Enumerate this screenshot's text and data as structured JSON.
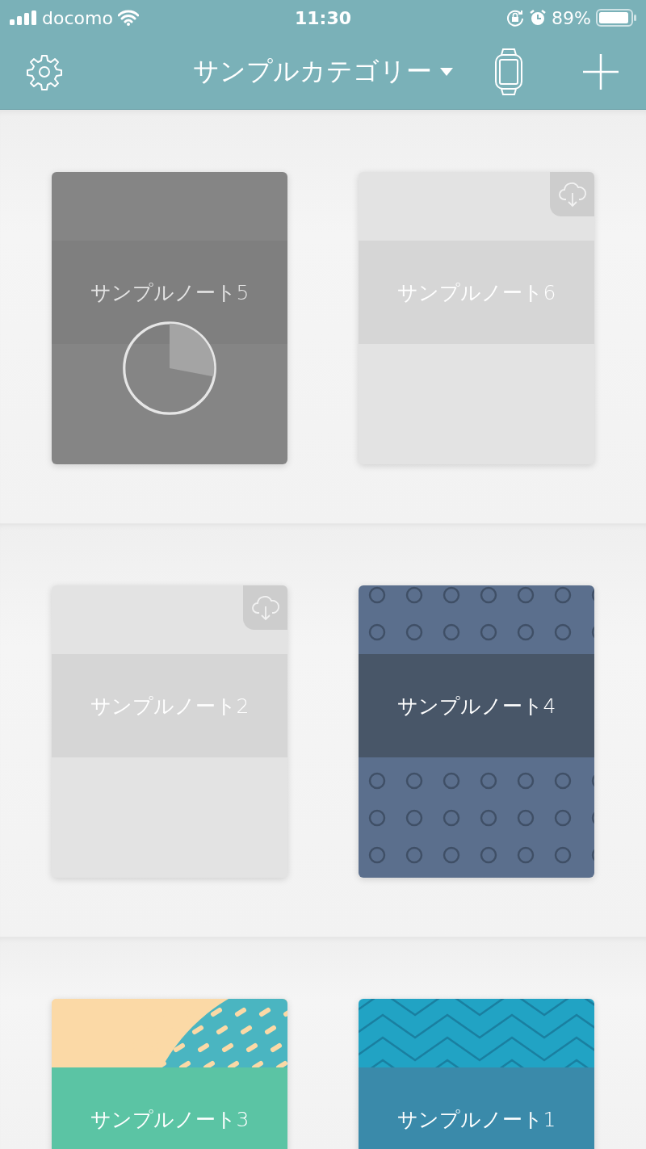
{
  "status_bar": {
    "carrier": "docomo",
    "time": "11:30",
    "battery": "89%"
  },
  "nav": {
    "title": "サンプルカテゴリー"
  },
  "shelves": [
    {
      "notes": [
        {
          "title": "サンプルノート5",
          "kind": "plain",
          "in_cloud": false,
          "downloading": true
        },
        {
          "title": "サンプルノート6",
          "kind": "plain",
          "in_cloud": true,
          "downloading": false
        }
      ]
    },
    {
      "notes": [
        {
          "title": "サンプルノート2",
          "kind": "plain",
          "in_cloud": true,
          "downloading": false
        },
        {
          "title": "サンプルノート4",
          "kind": "circles",
          "in_cloud": false,
          "downloading": false
        }
      ]
    },
    {
      "notes": [
        {
          "title": "サンプルノート3",
          "kind": "dots",
          "in_cloud": false,
          "downloading": false
        },
        {
          "title": "サンプルノート1",
          "kind": "chevron",
          "in_cloud": false,
          "downloading": false
        }
      ]
    }
  ]
}
